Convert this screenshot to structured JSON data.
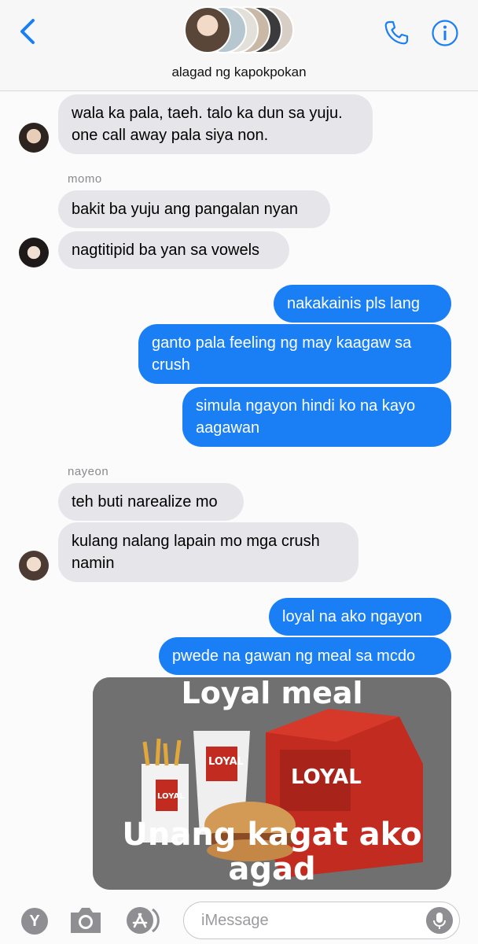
{
  "header": {
    "group_name": "alagad ng kapokpokan"
  },
  "messages": [
    {
      "dir": "in",
      "sender": "",
      "text": "wala ka pala, taeh. talo ka dun sa yuju. one call away pala siya non."
    },
    {
      "dir": "in",
      "sender": "momo",
      "text": "bakit ba yuju ang pangalan nyan"
    },
    {
      "dir": "in",
      "sender": "",
      "text": "nagtitipid ba yan sa vowels"
    },
    {
      "dir": "out",
      "text": "nakakainis pls lang"
    },
    {
      "dir": "out",
      "text": "ganto pala feeling ng may kaagaw sa crush"
    },
    {
      "dir": "out",
      "text": "simula ngayon hindi ko na kayo aagawan"
    },
    {
      "dir": "in",
      "sender": "nayeon",
      "text": "teh buti narealize mo"
    },
    {
      "dir": "in",
      "sender": "",
      "text": "kulang nalang lapain mo mga crush namin"
    },
    {
      "dir": "out",
      "text": "loyal na ako ngayon"
    },
    {
      "dir": "out",
      "text": "pwede na gawan ng meal sa mcdo"
    }
  ],
  "meme": {
    "top_text": "Loyal meal",
    "bottom_text": "Unang kagat ako agad",
    "box_label": "LOYAL",
    "cup_label": "LOYAL",
    "fries_label": "LOYAL"
  },
  "composer": {
    "placeholder": "iMessage",
    "app_icon_letter": "Y"
  },
  "colors": {
    "accent": "#1a7ff5",
    "incoming_bubble": "#e6e6ea",
    "header_bg": "#f7f7f7"
  }
}
